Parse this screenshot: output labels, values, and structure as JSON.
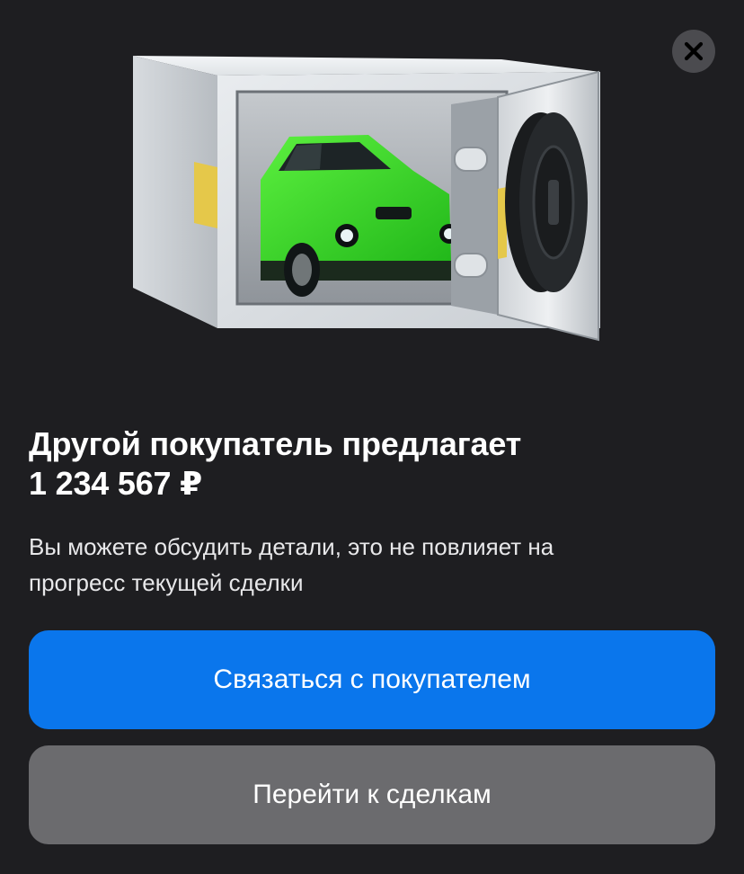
{
  "dialog": {
    "title_line1": "Другой покупатель предлагает",
    "title_line2": "1 234 567 ₽",
    "subtitle_line1": "Вы можете обсудить детали, это не повлияет на",
    "subtitle_line2": "прогресс текущей сделки",
    "primary_button": "Связаться с покупателем",
    "secondary_button": "Перейти к сделкам",
    "close_icon": "close-icon",
    "illustration": "safe-with-car-illustration"
  },
  "colors": {
    "background": "#1e1e21",
    "primary": "#0a76ec",
    "secondary": "#6b6b6e",
    "close_bg": "#4b4b4f",
    "car": "#3bdc2f"
  }
}
